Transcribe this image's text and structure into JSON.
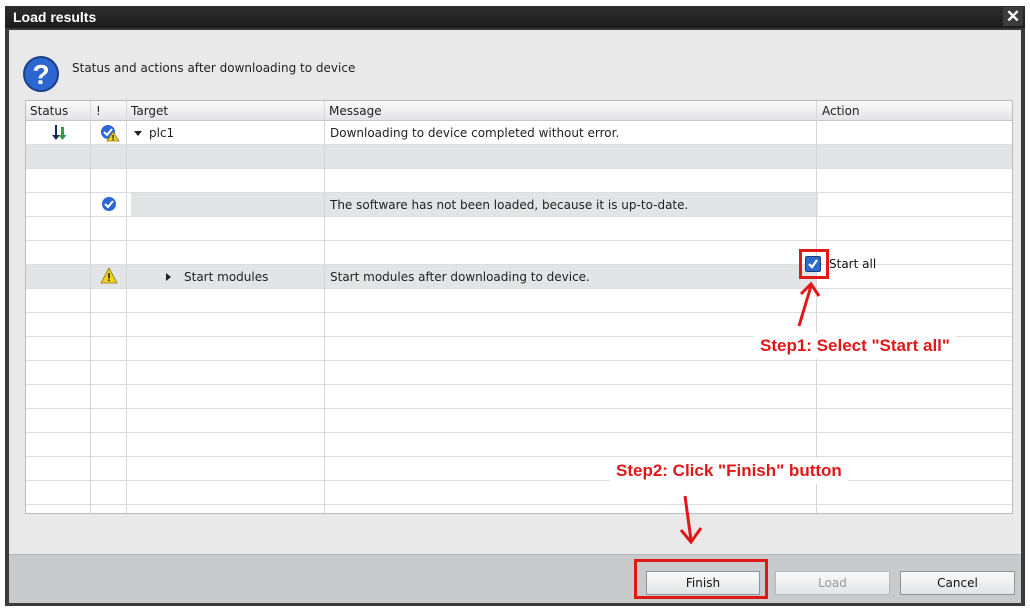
{
  "window": {
    "title": "Load results",
    "close_label": "✕"
  },
  "subtitle": "Status and actions after downloading to device",
  "columns": {
    "status": "Status",
    "alert": "!",
    "target": "Target",
    "message": "Message",
    "action": "Action"
  },
  "rows": [
    {
      "target": "plc1",
      "message": "Downloading to device completed without error.",
      "action": ""
    },
    {
      "target": "",
      "message": "",
      "action": ""
    },
    {
      "target": "",
      "message": "The software has not been loaded, because it is up-to-date.",
      "action": ""
    },
    {
      "target": "",
      "message": "",
      "action": ""
    },
    {
      "target": "Start modules",
      "message": "Start modules after downloading to device.",
      "action": "Start all",
      "checked": true
    }
  ],
  "annotations": {
    "step1": "Step1: Select \"Start all\"",
    "step2": "Step2: Click \"Finish\" button"
  },
  "buttons": {
    "finish": "Finish",
    "load": "Load",
    "cancel": "Cancel"
  },
  "colors": {
    "annotation_red": "#e01818",
    "checkbox_blue": "#2d6ad0",
    "titlebar": "#1c1c1c"
  },
  "icons": {
    "question": "question-icon",
    "download_status": "download-arrow-icon",
    "ok_warning": "ok-warning-icon",
    "ok": "ok-check-icon",
    "warning": "warning-icon"
  }
}
